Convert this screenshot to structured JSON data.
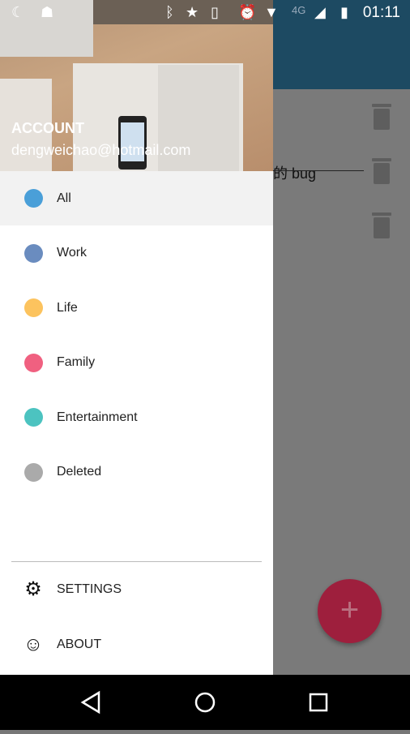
{
  "status_bar": {
    "time": "01:11",
    "network": "4G",
    "icons": [
      "moon-icon",
      "android-icon",
      "bluetooth-icon",
      "star-icon",
      "vibrate-icon",
      "alarm-icon",
      "wifi-icon",
      "signal-icon",
      "battery-charging-icon"
    ]
  },
  "background": {
    "note_text": "的 bug",
    "fab_label": "+"
  },
  "drawer": {
    "account_label": "ACCOUNT",
    "email": "dengweichao@hotmail.com",
    "categories": [
      {
        "label": "All",
        "color": "#4a9fd8",
        "selected": true
      },
      {
        "label": "Work",
        "color": "#6a8cbf"
      },
      {
        "label": "Life",
        "color": "#fcc35e"
      },
      {
        "label": "Family",
        "color": "#f06080"
      },
      {
        "label": "Entertainment",
        "color": "#4cc3c0"
      },
      {
        "label": "Deleted",
        "color": "#aaaaaa"
      }
    ],
    "settings_label": "SETTINGS",
    "about_label": "ABOUT"
  }
}
